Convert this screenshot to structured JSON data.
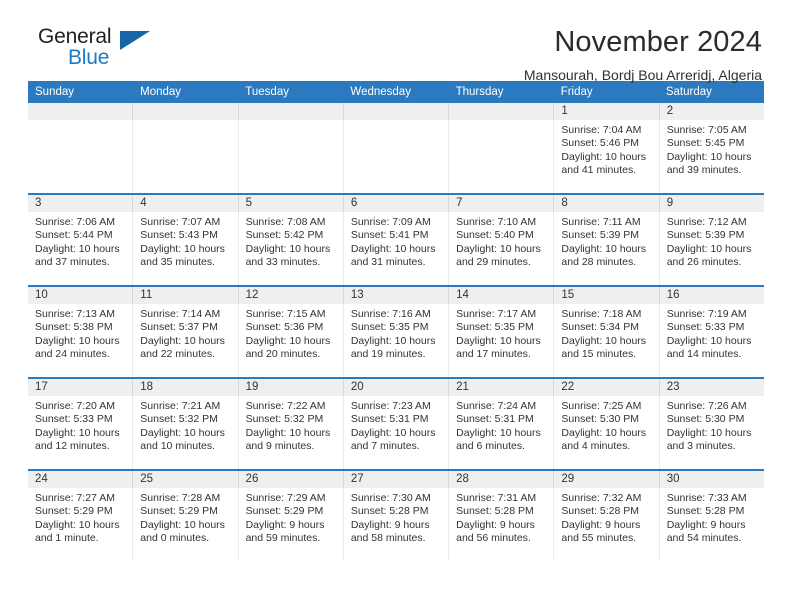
{
  "brand": {
    "name_part1": "General",
    "name_part2": "Blue",
    "flag_icon": "triangle-flag-icon"
  },
  "header": {
    "title": "November 2024",
    "location": "Mansourah, Bordj Bou Arreridj, Algeria"
  },
  "calendar": {
    "weekdays": [
      "Sunday",
      "Monday",
      "Tuesday",
      "Wednesday",
      "Thursday",
      "Friday",
      "Saturday"
    ],
    "colors": {
      "header_blue": "#2b7ac0",
      "daynum_band": "#efefef",
      "brand_blue": "#1f7ac4"
    },
    "weeks": [
      [
        {
          "day": "",
          "sunrise": "",
          "sunset": "",
          "daylight1": "",
          "daylight2": ""
        },
        {
          "day": "",
          "sunrise": "",
          "sunset": "",
          "daylight1": "",
          "daylight2": ""
        },
        {
          "day": "",
          "sunrise": "",
          "sunset": "",
          "daylight1": "",
          "daylight2": ""
        },
        {
          "day": "",
          "sunrise": "",
          "sunset": "",
          "daylight1": "",
          "daylight2": ""
        },
        {
          "day": "",
          "sunrise": "",
          "sunset": "",
          "daylight1": "",
          "daylight2": ""
        },
        {
          "day": "1",
          "sunrise": "Sunrise: 7:04 AM",
          "sunset": "Sunset: 5:46 PM",
          "daylight1": "Daylight: 10 hours",
          "daylight2": "and 41 minutes."
        },
        {
          "day": "2",
          "sunrise": "Sunrise: 7:05 AM",
          "sunset": "Sunset: 5:45 PM",
          "daylight1": "Daylight: 10 hours",
          "daylight2": "and 39 minutes."
        }
      ],
      [
        {
          "day": "3",
          "sunrise": "Sunrise: 7:06 AM",
          "sunset": "Sunset: 5:44 PM",
          "daylight1": "Daylight: 10 hours",
          "daylight2": "and 37 minutes."
        },
        {
          "day": "4",
          "sunrise": "Sunrise: 7:07 AM",
          "sunset": "Sunset: 5:43 PM",
          "daylight1": "Daylight: 10 hours",
          "daylight2": "and 35 minutes."
        },
        {
          "day": "5",
          "sunrise": "Sunrise: 7:08 AM",
          "sunset": "Sunset: 5:42 PM",
          "daylight1": "Daylight: 10 hours",
          "daylight2": "and 33 minutes."
        },
        {
          "day": "6",
          "sunrise": "Sunrise: 7:09 AM",
          "sunset": "Sunset: 5:41 PM",
          "daylight1": "Daylight: 10 hours",
          "daylight2": "and 31 minutes."
        },
        {
          "day": "7",
          "sunrise": "Sunrise: 7:10 AM",
          "sunset": "Sunset: 5:40 PM",
          "daylight1": "Daylight: 10 hours",
          "daylight2": "and 29 minutes."
        },
        {
          "day": "8",
          "sunrise": "Sunrise: 7:11 AM",
          "sunset": "Sunset: 5:39 PM",
          "daylight1": "Daylight: 10 hours",
          "daylight2": "and 28 minutes."
        },
        {
          "day": "9",
          "sunrise": "Sunrise: 7:12 AM",
          "sunset": "Sunset: 5:39 PM",
          "daylight1": "Daylight: 10 hours",
          "daylight2": "and 26 minutes."
        }
      ],
      [
        {
          "day": "10",
          "sunrise": "Sunrise: 7:13 AM",
          "sunset": "Sunset: 5:38 PM",
          "daylight1": "Daylight: 10 hours",
          "daylight2": "and 24 minutes."
        },
        {
          "day": "11",
          "sunrise": "Sunrise: 7:14 AM",
          "sunset": "Sunset: 5:37 PM",
          "daylight1": "Daylight: 10 hours",
          "daylight2": "and 22 minutes."
        },
        {
          "day": "12",
          "sunrise": "Sunrise: 7:15 AM",
          "sunset": "Sunset: 5:36 PM",
          "daylight1": "Daylight: 10 hours",
          "daylight2": "and 20 minutes."
        },
        {
          "day": "13",
          "sunrise": "Sunrise: 7:16 AM",
          "sunset": "Sunset: 5:35 PM",
          "daylight1": "Daylight: 10 hours",
          "daylight2": "and 19 minutes."
        },
        {
          "day": "14",
          "sunrise": "Sunrise: 7:17 AM",
          "sunset": "Sunset: 5:35 PM",
          "daylight1": "Daylight: 10 hours",
          "daylight2": "and 17 minutes."
        },
        {
          "day": "15",
          "sunrise": "Sunrise: 7:18 AM",
          "sunset": "Sunset: 5:34 PM",
          "daylight1": "Daylight: 10 hours",
          "daylight2": "and 15 minutes."
        },
        {
          "day": "16",
          "sunrise": "Sunrise: 7:19 AM",
          "sunset": "Sunset: 5:33 PM",
          "daylight1": "Daylight: 10 hours",
          "daylight2": "and 14 minutes."
        }
      ],
      [
        {
          "day": "17",
          "sunrise": "Sunrise: 7:20 AM",
          "sunset": "Sunset: 5:33 PM",
          "daylight1": "Daylight: 10 hours",
          "daylight2": "and 12 minutes."
        },
        {
          "day": "18",
          "sunrise": "Sunrise: 7:21 AM",
          "sunset": "Sunset: 5:32 PM",
          "daylight1": "Daylight: 10 hours",
          "daylight2": "and 10 minutes."
        },
        {
          "day": "19",
          "sunrise": "Sunrise: 7:22 AM",
          "sunset": "Sunset: 5:32 PM",
          "daylight1": "Daylight: 10 hours",
          "daylight2": "and 9 minutes."
        },
        {
          "day": "20",
          "sunrise": "Sunrise: 7:23 AM",
          "sunset": "Sunset: 5:31 PM",
          "daylight1": "Daylight: 10 hours",
          "daylight2": "and 7 minutes."
        },
        {
          "day": "21",
          "sunrise": "Sunrise: 7:24 AM",
          "sunset": "Sunset: 5:31 PM",
          "daylight1": "Daylight: 10 hours",
          "daylight2": "and 6 minutes."
        },
        {
          "day": "22",
          "sunrise": "Sunrise: 7:25 AM",
          "sunset": "Sunset: 5:30 PM",
          "daylight1": "Daylight: 10 hours",
          "daylight2": "and 4 minutes."
        },
        {
          "day": "23",
          "sunrise": "Sunrise: 7:26 AM",
          "sunset": "Sunset: 5:30 PM",
          "daylight1": "Daylight: 10 hours",
          "daylight2": "and 3 minutes."
        }
      ],
      [
        {
          "day": "24",
          "sunrise": "Sunrise: 7:27 AM",
          "sunset": "Sunset: 5:29 PM",
          "daylight1": "Daylight: 10 hours",
          "daylight2": "and 1 minute."
        },
        {
          "day": "25",
          "sunrise": "Sunrise: 7:28 AM",
          "sunset": "Sunset: 5:29 PM",
          "daylight1": "Daylight: 10 hours",
          "daylight2": "and 0 minutes."
        },
        {
          "day": "26",
          "sunrise": "Sunrise: 7:29 AM",
          "sunset": "Sunset: 5:29 PM",
          "daylight1": "Daylight: 9 hours",
          "daylight2": "and 59 minutes."
        },
        {
          "day": "27",
          "sunrise": "Sunrise: 7:30 AM",
          "sunset": "Sunset: 5:28 PM",
          "daylight1": "Daylight: 9 hours",
          "daylight2": "and 58 minutes."
        },
        {
          "day": "28",
          "sunrise": "Sunrise: 7:31 AM",
          "sunset": "Sunset: 5:28 PM",
          "daylight1": "Daylight: 9 hours",
          "daylight2": "and 56 minutes."
        },
        {
          "day": "29",
          "sunrise": "Sunrise: 7:32 AM",
          "sunset": "Sunset: 5:28 PM",
          "daylight1": "Daylight: 9 hours",
          "daylight2": "and 55 minutes."
        },
        {
          "day": "30",
          "sunrise": "Sunrise: 7:33 AM",
          "sunset": "Sunset: 5:28 PM",
          "daylight1": "Daylight: 9 hours",
          "daylight2": "and 54 minutes."
        }
      ]
    ]
  }
}
